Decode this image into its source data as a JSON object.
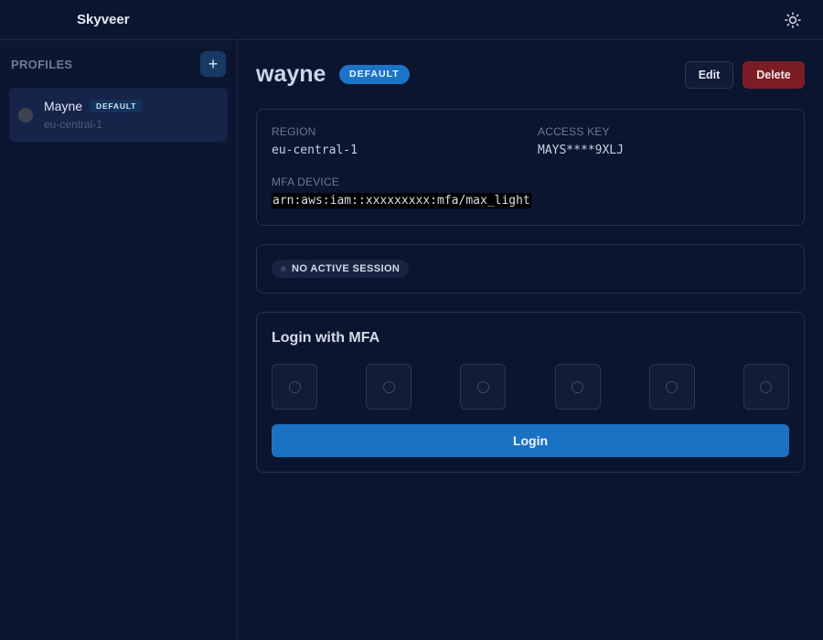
{
  "app": {
    "title": "Skyveer",
    "theme_icon": "sun-icon"
  },
  "sidebar": {
    "heading": "PROFILES",
    "add_label": "+",
    "profiles": [
      {
        "name": "Mayne",
        "badge": "DEFAULT",
        "region": "eu-central-1",
        "selected": true
      }
    ]
  },
  "main": {
    "profile_name": "wayne",
    "badge": "DEFAULT",
    "edit_label": "Edit",
    "delete_label": "Delete",
    "details": {
      "region_label": "REGION",
      "region_value": "eu-central-1",
      "access_key_label": "ACCESS KEY",
      "access_key_value": "MAYS****9XLJ",
      "mfa_label": "MFA DEVICE",
      "mfa_value": "arn:aws:iam::xxxxxxxxx:mfa/max_light"
    },
    "session": {
      "status": "NO ACTIVE SESSION"
    },
    "login": {
      "title": "Login with MFA",
      "code_digits": 6,
      "button_label": "Login"
    }
  },
  "colors": {
    "background": "#0c1530",
    "accent": "#1b72c4",
    "danger": "#7a1d24"
  }
}
